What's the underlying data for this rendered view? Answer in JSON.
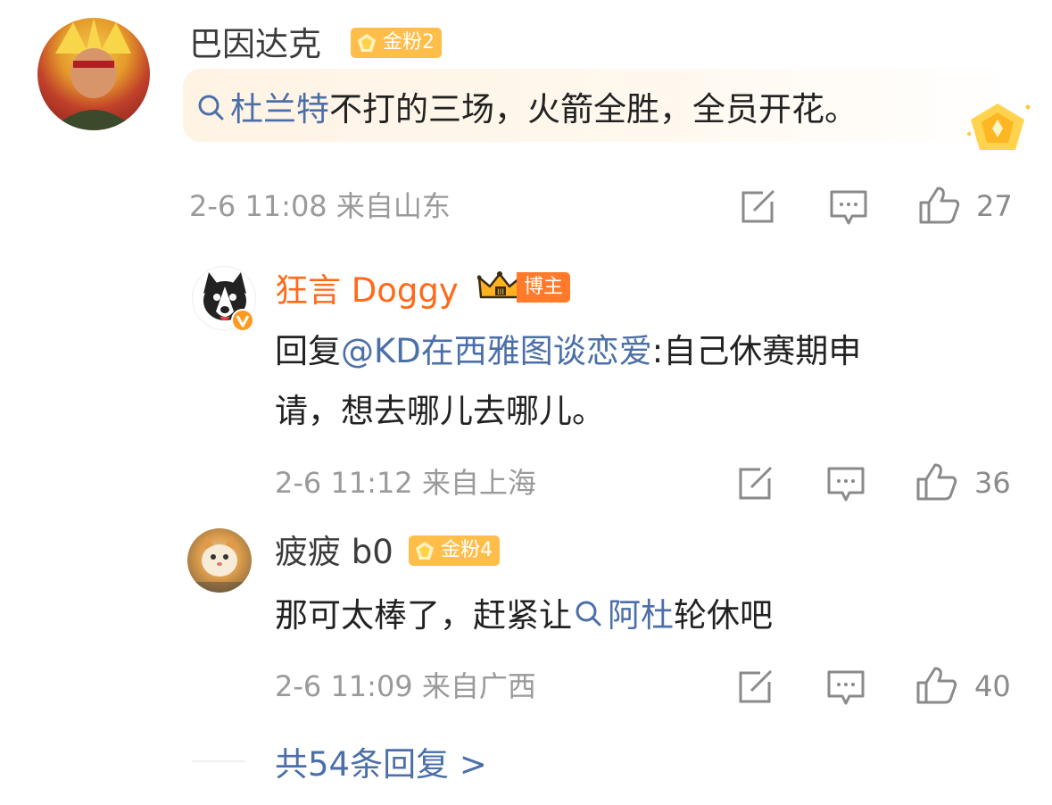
{
  "comment": {
    "username": "巴因达克",
    "badge": "金粉2",
    "text_link": "杜兰特",
    "text_rest": "不打的三场，火箭全胜，全员开花。",
    "time": "2-6 11:08",
    "location": "来自山东",
    "likes": "27"
  },
  "replies": [
    {
      "username": "狂言 Doggy",
      "badge": "博主",
      "prefix": "回复",
      "mention": "@KD在西雅图谈恋爱",
      "text_line1": ":自己休赛期申",
      "text_line2": "请，想去哪儿去哪儿。",
      "time": "2-6 11:12",
      "location": "来自上海",
      "likes": "36"
    },
    {
      "username": "疲疲 b0",
      "badge": "金粉4",
      "text_pre": "那可太棒了，赶紧让",
      "text_link": "阿杜",
      "text_post": "轮休吧",
      "time": "2-6 11:09",
      "location": "来自广西",
      "likes": "40"
    }
  ],
  "more_replies": "共54条回复 >",
  "icons": [
    "repost-icon",
    "comment-icon",
    "like-icon",
    "search-icon",
    "verified-icon",
    "crown-icon",
    "gem-icon"
  ],
  "colors": {
    "link": "#4b6fa8",
    "orange": "#ff6a1a",
    "badge": "#ffbe4a",
    "meta": "#9a9a9a"
  }
}
